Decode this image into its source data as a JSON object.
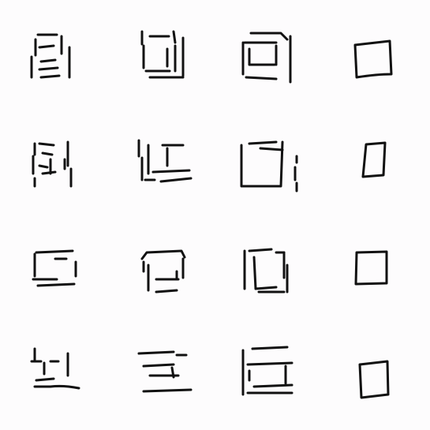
{
  "background": "#fdfcfd",
  "stroke_color": "#111111",
  "grid": {
    "rows": 4,
    "columns": 4
  },
  "rows": [
    {
      "row": 1,
      "cells": [
        {
          "column": 1,
          "shape": "fragmented-square"
        },
        {
          "column": 2,
          "shape": "fragmented-square"
        },
        {
          "column": 3,
          "shape": "double-outlined-square"
        },
        {
          "column": 4,
          "shape": "closed-square"
        }
      ]
    },
    {
      "row": 2,
      "cells": [
        {
          "column": 1,
          "shape": "fragmented-square"
        },
        {
          "column": 2,
          "shape": "fragmented-square"
        },
        {
          "column": 3,
          "shape": "square-with-inner-corner"
        },
        {
          "column": 4,
          "shape": "closed-rectangle"
        }
      ]
    },
    {
      "row": 3,
      "cells": [
        {
          "column": 1,
          "shape": "fragmented-square"
        },
        {
          "column": 2,
          "shape": "fragmented-square"
        },
        {
          "column": 3,
          "shape": "square-with-inner-corner"
        },
        {
          "column": 4,
          "shape": "closed-square"
        }
      ]
    },
    {
      "row": 4,
      "cells": [
        {
          "column": 1,
          "shape": "fragmented-square"
        },
        {
          "column": 2,
          "shape": "fragmented-square"
        },
        {
          "column": 3,
          "shape": "double-outlined-square"
        },
        {
          "column": 4,
          "shape": "closed-square"
        }
      ]
    }
  ]
}
